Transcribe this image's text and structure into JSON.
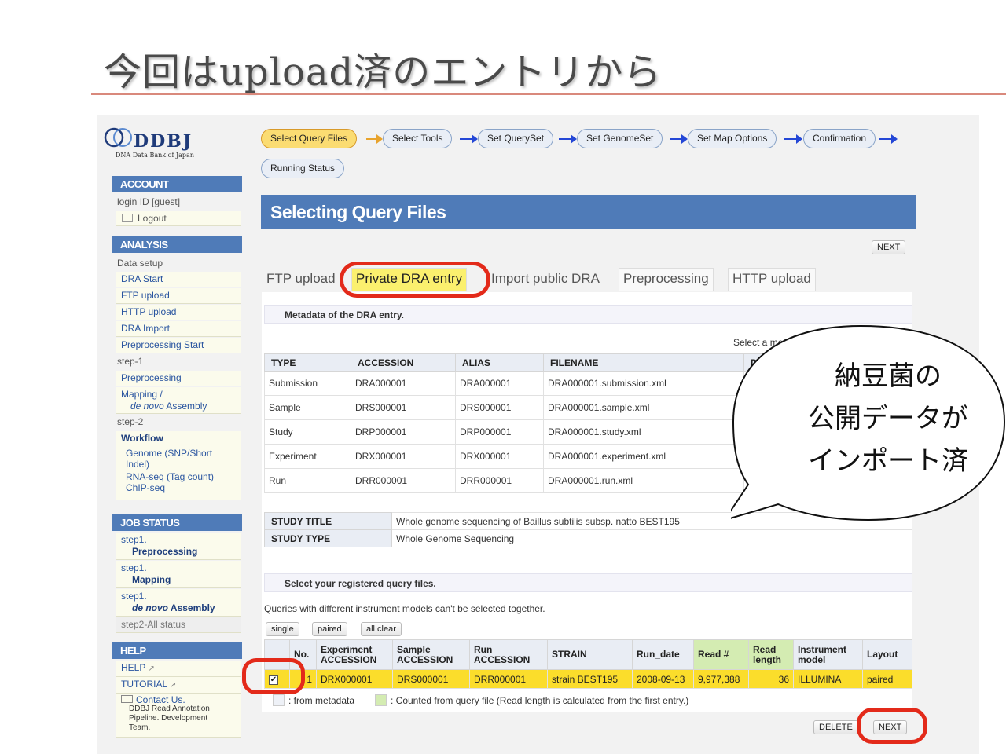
{
  "slide": {
    "title": "今回はupload済のエントリから"
  },
  "logo": {
    "name": "DDBJ",
    "subtitle": "DNA Data Bank of Japan"
  },
  "sidebar": {
    "account_header": "ACCOUNT",
    "login_id": "login ID [guest]",
    "logout": "Logout",
    "analysis_header": "ANALYSIS",
    "data_setup": "Data setup",
    "dra_start": "DRA Start",
    "ftp_upload": "FTP upload",
    "http_upload": "HTTP upload",
    "dra_import": "DRA Import",
    "preprocessing_start": "Preprocessing Start",
    "step1": "step-1",
    "preprocessing": "Preprocessing",
    "mapping": "Mapping /",
    "de_novo": "de novo",
    "assembly": "Assembly",
    "step2": "step-2",
    "workflow": "Workflow",
    "genome": "Genome (SNP/Short Indel)",
    "rnaseq": "RNA-seq (Tag count)",
    "chipseq": "ChIP-seq",
    "job_status_header": "JOB STATUS",
    "job1_step": "step1.",
    "job1_name": "Preprocessing",
    "job2_step": "step1.",
    "job2_name": "Mapping",
    "job3_step": "step1.",
    "job3_name_it": "de novo",
    "job3_name": "Assembly",
    "job_all": "step2-All status",
    "help_header": "HELP",
    "help": "HELP",
    "tutorial": "TUTORIAL",
    "contact": "Contact Us.",
    "team": "DDBJ Read Annotation Pipeline. Development Team."
  },
  "wizard": {
    "steps": [
      "Select Query Files",
      "Select Tools",
      "Set QuerySet",
      "Set GenomeSet",
      "Set Map Options",
      "Confirmation"
    ],
    "running_status": "Running Status"
  },
  "page": {
    "title": "Selecting Query Files",
    "next": "NEXT",
    "delete": "DELETE",
    "next_bottom": "NEXT"
  },
  "tabs": [
    "FTP upload",
    "Private DRA entry",
    "Import public DRA",
    "Preprocessing",
    "HTTP upload"
  ],
  "metadata": {
    "header": "Metadata of the DRA entry.",
    "select_note": "Select a metad",
    "columns": [
      "TYPE",
      "ACCESSION",
      "ALIAS",
      "FILENAME",
      "DL"
    ],
    "rows": [
      [
        "Submission",
        "DRA000001",
        "DRA000001",
        "DRA000001.submission.xml"
      ],
      [
        "Sample",
        "DRS000001",
        "DRS000001",
        "DRA000001.sample.xml"
      ],
      [
        "Study",
        "DRP000001",
        "DRP000001",
        "DRA000001.study.xml"
      ],
      [
        "Experiment",
        "DRX000001",
        "DRX000001",
        "DRA000001.experiment.xml"
      ],
      [
        "Run",
        "DRR000001",
        "DRR000001",
        "DRA000001.run.xml"
      ]
    ]
  },
  "study": {
    "title_label": "STUDY TITLE",
    "title_value": "Whole genome sequencing of Baillus subtilis subsp. natto BEST195",
    "type_label": "STUDY TYPE",
    "type_value": "Whole Genome Sequencing"
  },
  "query": {
    "header": "Select your registered query files.",
    "note": "Queries with different instrument models can't be selected together.",
    "btn_single": "single",
    "btn_paired": "paired",
    "btn_clear": "all clear",
    "columns": [
      "",
      "No.",
      "Experiment ACCESSION",
      "Sample ACCESSION",
      "Run ACCESSION",
      "STRAIN",
      "Run_date",
      "Read #",
      "Read length",
      "Instrument model",
      "Layout"
    ],
    "row": [
      "1",
      "DRX000001",
      "DRS000001",
      "DRR000001",
      "strain BEST195",
      "2008-09-13",
      "9,977,388",
      "36",
      "ILLUMINA",
      "paired"
    ],
    "legend_meta": ": from metadata",
    "legend_query": ": Counted from query file (Read length is calculated from the first entry.)"
  },
  "callout": {
    "lines": [
      "納豆菌の",
      "公開データが",
      "インポート済"
    ]
  },
  "colors": {
    "accent_blue": "#4f7bb8",
    "highlight": "#fbdd2b",
    "ring": "#e32a1a",
    "counted": "#d4ecb2"
  }
}
